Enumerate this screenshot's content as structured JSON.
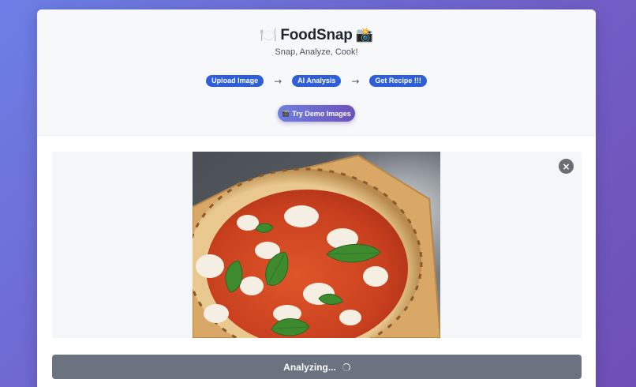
{
  "app": {
    "title": "FoodSnap",
    "title_icon_left": "🍽️",
    "title_icon_right": "📸",
    "subtitle": "Snap, Analyze, Cook!"
  },
  "steps": [
    {
      "label": "Upload Image"
    },
    {
      "label": "AI Analysis"
    },
    {
      "label": "Get Recipe !!!"
    }
  ],
  "step_arrow": "→",
  "demo_button": {
    "icon": "🎬",
    "label": "Try Demo Images"
  },
  "preview": {
    "image": "margherita pizza photo",
    "close_icon": "×"
  },
  "analyze_button": {
    "label": "Analyzing..."
  },
  "colors": {
    "background_start": "#6c7fe6",
    "background_end": "#6f4fb5",
    "step_pill": "#2f5fd8",
    "analyze_button": "#6b7280",
    "close_button": "#6b6e74"
  }
}
